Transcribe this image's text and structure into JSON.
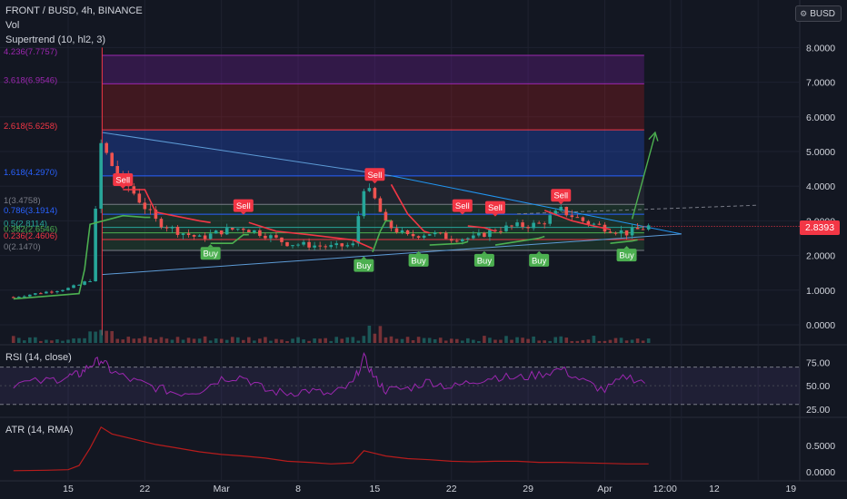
{
  "header": {
    "symbol_line": "FRONT / BUSD, 4h, BINANCE",
    "vol_label": "Vol",
    "supertrend_label": "Supertrend (10, hl2, 3)",
    "currency_button": "BUSD"
  },
  "colors": {
    "background": "#131722",
    "up": "#26a69a",
    "down": "#ef5350",
    "supertrend_up": "#4caf50",
    "supertrend_down": "#f23645",
    "fib_blue": "#2962ff",
    "fib_red": "#f23645",
    "fib_purple": "#7b1fa2",
    "rsi": "#9c27b0",
    "atr": "#b71c1c",
    "trendline": "#2196f3"
  },
  "price_axis": {
    "ticks": [
      "8.0000",
      "7.0000",
      "6.0000",
      "5.0000",
      "4.0000",
      "3.0000",
      "2.0000",
      "1.0000",
      "0.0000"
    ],
    "last_price": "2.8393"
  },
  "time_axis": {
    "labels": [
      "15",
      "22",
      "Mar",
      "8",
      "15",
      "22",
      "29",
      "Apr",
      "12:00",
      "12",
      "19"
    ]
  },
  "fib_levels": [
    {
      "label": "4.236(7.7757)",
      "value": 7.7757
    },
    {
      "label": "3.618(6.9546)",
      "value": 6.9546
    },
    {
      "label": "2.618(5.6258)",
      "value": 5.6258
    },
    {
      "label": "1.618(4.2970)",
      "value": 4.297
    },
    {
      "label": "1(3.4758)",
      "value": 3.4758
    },
    {
      "label": "0.786(3.1914)",
      "value": 3.1914
    },
    {
      "label": "0.5(2.8114)",
      "value": 2.8114
    },
    {
      "label": "0.382(2.6546)",
      "value": 2.6546
    },
    {
      "label": "0.236(2.4606)",
      "value": 2.4606
    },
    {
      "label": "0(2.1470)",
      "value": 2.147
    }
  ],
  "signals": [
    {
      "label": "Sell",
      "date": "Feb 20",
      "value": 3.9,
      "type": "sell"
    },
    {
      "label": "Buy",
      "date": "Feb 28",
      "value": 2.35,
      "type": "buy"
    },
    {
      "label": "Sell",
      "date": "Mar 3",
      "value": 3.15,
      "type": "sell"
    },
    {
      "label": "Buy",
      "date": "Mar 14",
      "value": 2.0,
      "type": "buy"
    },
    {
      "label": "Sell",
      "date": "Mar 15",
      "value": 4.05,
      "type": "sell"
    },
    {
      "label": "Buy",
      "date": "Mar 19",
      "value": 2.15,
      "type": "buy"
    },
    {
      "label": "Sell",
      "date": "Mar 23",
      "value": 3.15,
      "type": "sell"
    },
    {
      "label": "Buy",
      "date": "Mar 25",
      "value": 2.15,
      "type": "buy"
    },
    {
      "label": "Sell",
      "date": "Mar 26",
      "value": 3.1,
      "type": "sell"
    },
    {
      "label": "Buy",
      "date": "Mar 30",
      "value": 2.15,
      "type": "buy"
    },
    {
      "label": "Sell",
      "date": "Apr 1",
      "value": 3.45,
      "type": "sell"
    },
    {
      "label": "Buy",
      "date": "Apr 7",
      "value": 2.3,
      "type": "buy"
    }
  ],
  "rsi": {
    "label": "RSI (14, close)",
    "ticks": [
      "75.00",
      "50.00",
      "25.00"
    ],
    "upper_band": 70,
    "lower_band": 30
  },
  "atr": {
    "label": "ATR (14, RMA)",
    "ticks": [
      "0.5000",
      "0.0000"
    ]
  },
  "chart_data": {
    "type": "line",
    "title": "FRONT / BUSD, 4h, BINANCE",
    "price_series": {
      "name": "FRONT / BUSD",
      "x": [
        "Feb 10",
        "Feb 13",
        "Feb 15",
        "Feb 16",
        "Feb 17",
        "Feb 18",
        "Feb 19",
        "Feb 21",
        "Feb 23",
        "Feb 25",
        "Feb 27",
        "Mar 1",
        "Mar 3",
        "Mar 5",
        "Mar 7",
        "Mar 9",
        "Mar 11",
        "Mar 13",
        "Mar 14",
        "Mar 15",
        "Mar 16",
        "Mar 18",
        "Mar 20",
        "Mar 22",
        "Mar 24",
        "Mar 26",
        "Mar 28",
        "Mar 30",
        "Apr 1",
        "Apr 3",
        "Apr 5",
        "Apr 7",
        "Apr 9"
      ],
      "values": [
        0.8,
        0.95,
        1.05,
        1.15,
        1.3,
        5.2,
        4.6,
        3.8,
        3.0,
        2.7,
        2.5,
        2.7,
        2.8,
        2.6,
        2.35,
        2.3,
        2.25,
        2.3,
        4.0,
        3.6,
        2.9,
        2.55,
        2.65,
        2.5,
        2.5,
        2.75,
        2.85,
        2.9,
        3.3,
        3.0,
        2.8,
        2.65,
        2.84
      ]
    },
    "rsi_values": [
      52,
      55,
      60,
      62,
      72,
      78,
      65,
      55,
      48,
      42,
      45,
      58,
      60,
      45,
      42,
      45,
      40,
      52,
      80,
      58,
      45,
      47,
      55,
      48,
      55,
      60,
      58,
      62,
      68,
      55,
      45,
      60,
      53
    ],
    "atr_values": [
      0.02,
      0.03,
      0.04,
      0.12,
      0.45,
      0.85,
      0.72,
      0.62,
      0.52,
      0.45,
      0.38,
      0.33,
      0.3,
      0.26,
      0.2,
      0.18,
      0.15,
      0.17,
      0.4,
      0.35,
      0.3,
      0.25,
      0.23,
      0.2,
      0.19,
      0.2,
      0.2,
      0.18,
      0.18,
      0.17,
      0.16,
      0.15,
      0.15
    ],
    "ylim": [
      0,
      8.4
    ],
    "rsi_ylim": [
      20,
      90
    ],
    "atr_ylim": [
      0,
      0.95
    ],
    "grid": true
  }
}
